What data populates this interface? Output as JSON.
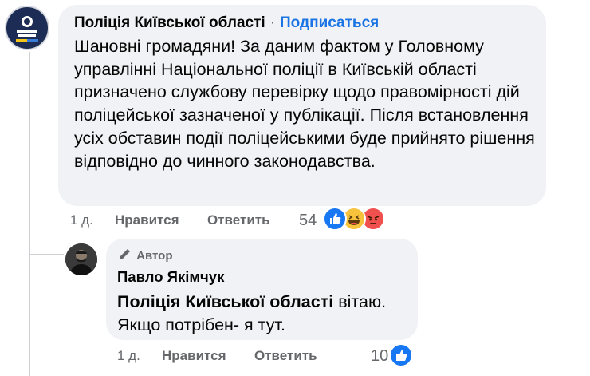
{
  "comment": {
    "page_name": "Поліція Київської області",
    "separator": "·",
    "subscribe_label": "Подписаться",
    "text": "Шановні громадяни! За даним фактом у Головному управлінні Національної поліції в Київській області призначено службову перевірку щодо правомірності дій поліцейської зазначеної у публікації. Після встановлення усіх обставин події поліцейськими буде прийнято рішення відповідно до чинного законодавства.",
    "time": "1 д.",
    "like_label": "Нравится",
    "reply_label": "Ответить",
    "reaction_count": "54",
    "reactions": [
      "like-icon",
      "haha-icon",
      "angry-icon"
    ]
  },
  "reply": {
    "author_badge": "Автор",
    "author_name": "Павло Якімчук",
    "mention": "Поліція Київської області",
    "text_after_mention": " вітаю.",
    "text_line2": "Якщо потрібен- я тут.",
    "time": "1 д.",
    "like_label": "Нравится",
    "reply_label": "Ответить",
    "reaction_count": "10",
    "reactions": [
      "like-icon"
    ]
  },
  "colors": {
    "bubble": "#f0f2f5",
    "link": "#1b74e4",
    "secondary_text": "#65676b",
    "like": "#1877f2",
    "haha": "#f7c33c",
    "angry": "#f0514e"
  }
}
